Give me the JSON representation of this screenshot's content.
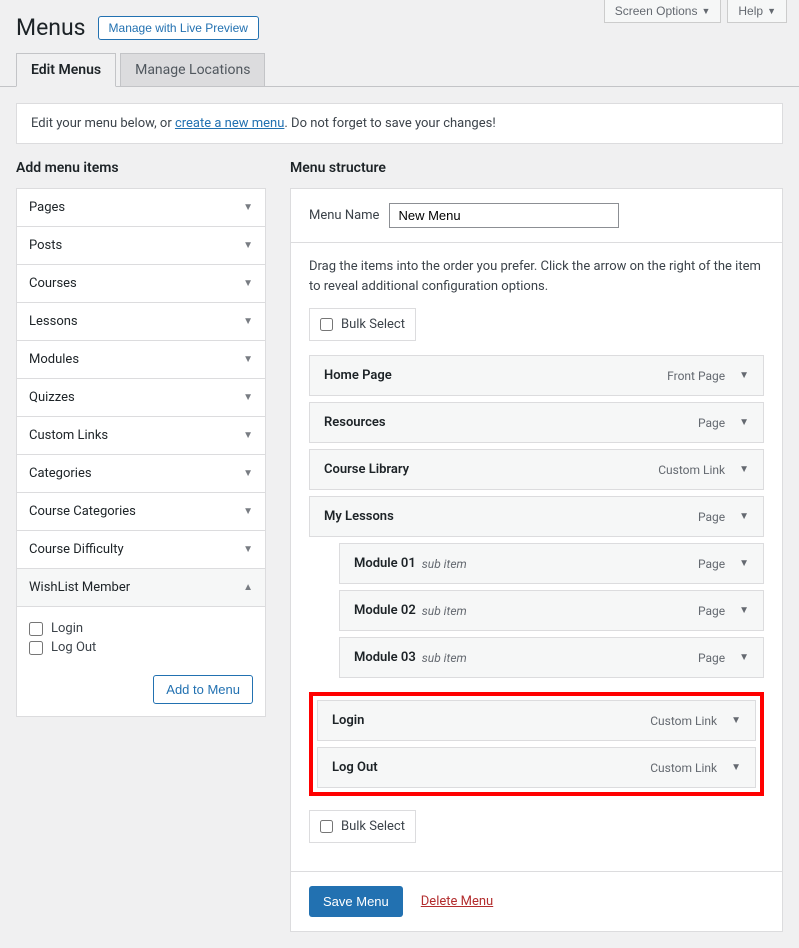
{
  "topButtons": {
    "screenOptions": "Screen Options",
    "help": "Help"
  },
  "page": {
    "title": "Menus",
    "livePreview": "Manage with Live Preview"
  },
  "tabs": {
    "edit": "Edit Menus",
    "locations": "Manage Locations"
  },
  "notice": {
    "pre": "Edit your menu below, or ",
    "link": "create a new menu",
    "post": ". Do not forget to save your changes!"
  },
  "left": {
    "heading": "Add menu items",
    "items": [
      {
        "label": "Pages",
        "expanded": false
      },
      {
        "label": "Posts",
        "expanded": false
      },
      {
        "label": "Courses",
        "expanded": false
      },
      {
        "label": "Lessons",
        "expanded": false
      },
      {
        "label": "Modules",
        "expanded": false
      },
      {
        "label": "Quizzes",
        "expanded": false
      },
      {
        "label": "Custom Links",
        "expanded": false
      },
      {
        "label": "Categories",
        "expanded": false
      },
      {
        "label": "Course Categories",
        "expanded": false
      },
      {
        "label": "Course Difficulty",
        "expanded": false
      },
      {
        "label": "WishList Member",
        "expanded": true
      }
    ],
    "wlmOptions": {
      "login": "Login",
      "logout": "Log Out"
    },
    "addBtn": "Add to Menu"
  },
  "right": {
    "heading": "Menu structure",
    "nameLabel": "Menu Name",
    "nameValue": "New Menu",
    "help": "Drag the items into the order you prefer. Click the arrow on the right of the item to reveal additional configuration options.",
    "bulkSelect": "Bulk Select",
    "items": [
      {
        "title": "Home Page",
        "type": "Front Page",
        "level": 0
      },
      {
        "title": "Resources",
        "type": "Page",
        "level": 0
      },
      {
        "title": "Course Library",
        "type": "Custom Link",
        "level": 0
      },
      {
        "title": "My Lessons",
        "type": "Page",
        "level": 0
      },
      {
        "title": "Module 01",
        "type": "Page",
        "level": 1,
        "sub": "sub item"
      },
      {
        "title": "Module 02",
        "type": "Page",
        "level": 1,
        "sub": "sub item"
      },
      {
        "title": "Module 03",
        "type": "Page",
        "level": 1,
        "sub": "sub item"
      }
    ],
    "highlighted": [
      {
        "title": "Login",
        "type": "Custom Link"
      },
      {
        "title": "Log Out",
        "type": "Custom Link"
      }
    ],
    "saveBtn": "Save Menu",
    "deleteLink": "Delete Menu"
  }
}
